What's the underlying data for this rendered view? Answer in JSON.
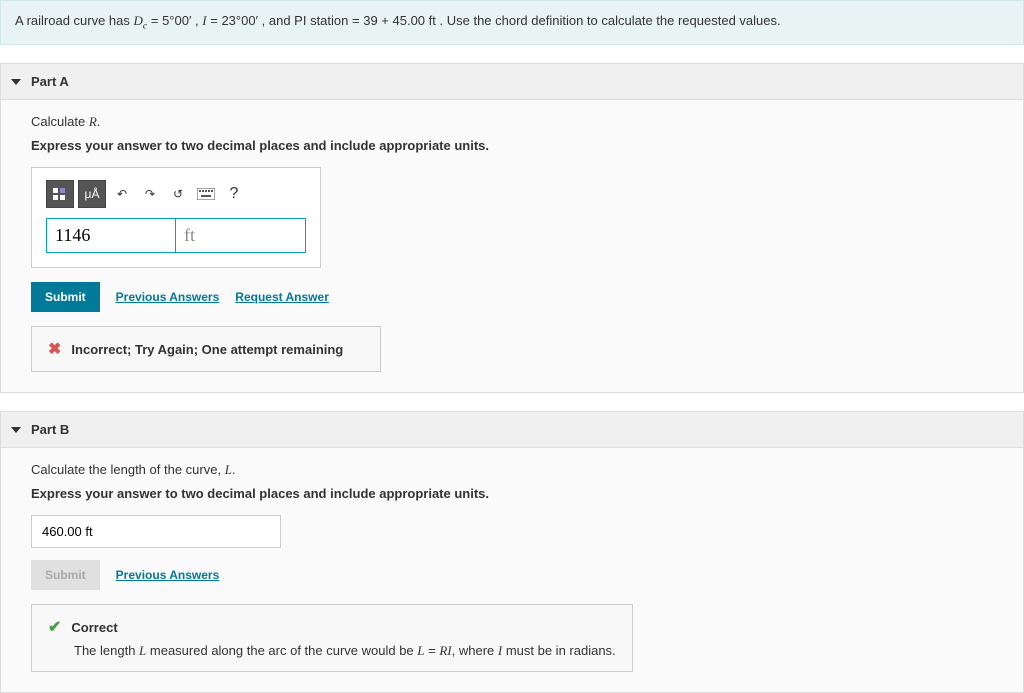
{
  "problem": {
    "prefix": "A railroad curve has ",
    "dc_var": "D",
    "dc_sub": "c",
    "eq": " = ",
    "dc_val": "5°00′",
    "comma": ", ",
    "i_var": "I",
    "i_val": "23°00′",
    "and": ", and ",
    "pi_label": "PI station",
    "pi_val": "39 + 45.00 ft",
    "suffix": ". Use the chord definition to calculate the requested values."
  },
  "partA": {
    "title": "Part A",
    "prompt_pre": "Calculate ",
    "prompt_var": "R",
    "prompt_post": ".",
    "instruction": "Express your answer to two decimal places and include appropriate units.",
    "toolbar": {
      "units_mu": "μÅ",
      "help": "?"
    },
    "value": "1146",
    "unit": "ft",
    "submit": "Submit",
    "prev": "Previous Answers",
    "request": "Request Answer",
    "feedback": "Incorrect; Try Again; One attempt remaining"
  },
  "partB": {
    "title": "Part B",
    "prompt_pre": "Calculate the length of the curve, ",
    "prompt_var": "L",
    "prompt_post": ".",
    "instruction": "Express your answer to two decimal places and include appropriate units.",
    "value": "460.00 ft",
    "submit": "Submit",
    "prev": "Previous Answers",
    "feedback_title": "Correct",
    "feedback_pre": "The length ",
    "feedback_L": "L",
    "feedback_mid": " measured along the arc of the curve would be ",
    "feedback_eq_L": "L",
    "feedback_eq_eq": " = ",
    "feedback_eq_RI": "RI",
    "feedback_mid2": ", where ",
    "feedback_I": "I",
    "feedback_post": " must be in radians."
  }
}
